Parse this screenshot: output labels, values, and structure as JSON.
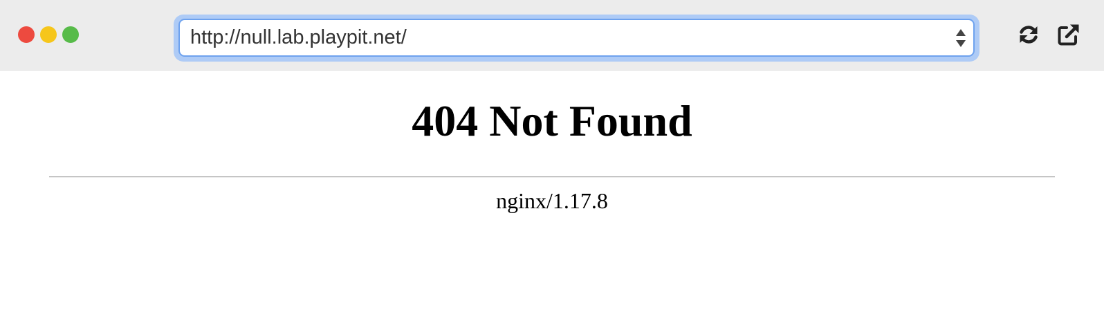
{
  "browser": {
    "url": "http://null.lab.playpit.net/",
    "toolbar_icons": [
      "reload-icon",
      "open-external-icon"
    ],
    "colors": {
      "toolbar": "#ececec",
      "focus_ring": "#aecbf6",
      "address_border": "#6ea2ee",
      "close": "#ed4a3f",
      "minimize": "#f6c61b",
      "maximize": "#57bb49"
    }
  },
  "page": {
    "title": "404 Not Found",
    "server": "nginx/1.17.8"
  }
}
